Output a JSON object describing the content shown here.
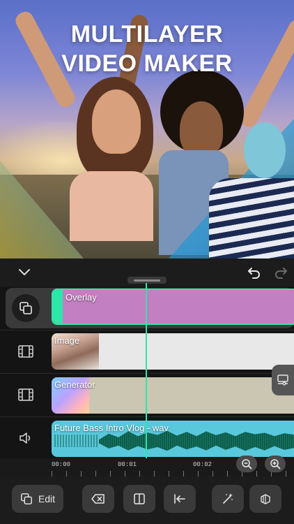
{
  "hero": {
    "title_line1": "MULTILAYER",
    "title_line2": "VIDEO MAKER"
  },
  "toolbar": {
    "collapse_icon": "chevron-down-icon",
    "undo_icon": "undo-icon",
    "redo_icon": "redo-icon"
  },
  "tracks": [
    {
      "type": "overlay",
      "icon": "layers-icon",
      "label": "Overlay",
      "selected": true,
      "color": "#c27fc1"
    },
    {
      "type": "image",
      "icon": "film-icon",
      "label": "Image",
      "color": "#e8e8e8"
    },
    {
      "type": "generator",
      "icon": "film-icon",
      "label": "Generator",
      "color": "#cac6b2"
    },
    {
      "type": "audio",
      "icon": "speaker-icon",
      "label": "Future Bass Intro Vlog - wav",
      "color": "#5ac8dc"
    }
  ],
  "ruler": {
    "labels": [
      "00:00",
      "00:01",
      "00:02"
    ]
  },
  "bottom_bar": {
    "edit_label": "Edit"
  },
  "colors": {
    "accent": "#2ee6a8",
    "background": "#151515"
  }
}
